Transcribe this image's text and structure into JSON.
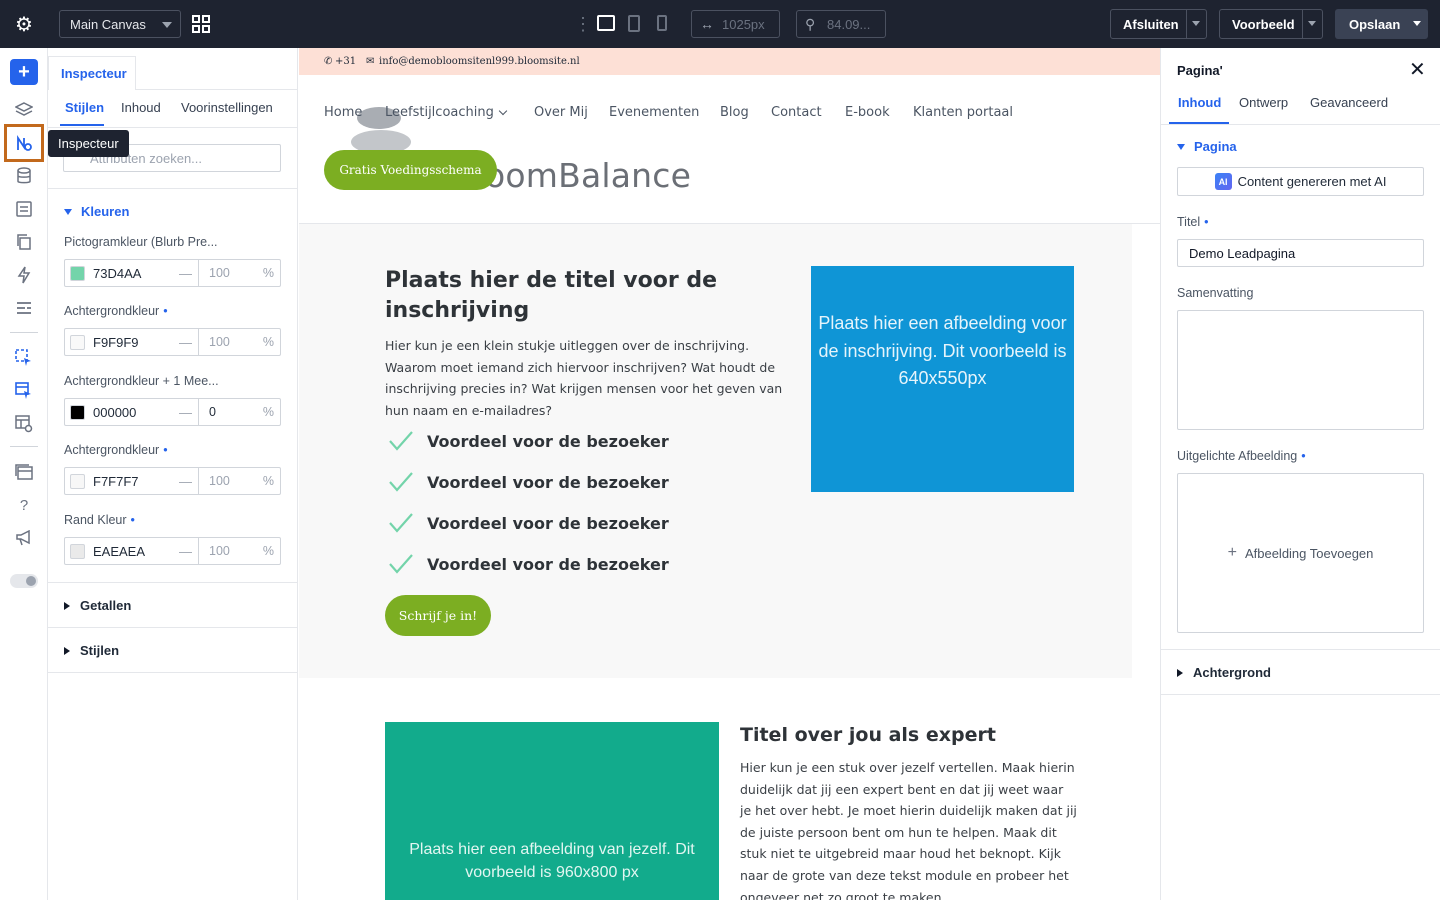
{
  "topbar": {
    "canvas_select": "Main Canvas",
    "width_value": "1025px",
    "zoom_value": "84.09...",
    "close_label": "Afsluiten",
    "preview_label": "Voorbeeld",
    "save_label": "Opslaan"
  },
  "rail": {
    "tooltip": "Inspecteur",
    "help_glyph": "?"
  },
  "inspector": {
    "tab_label": "Inspecteur",
    "subtabs": [
      "Stijlen",
      "Inhoud",
      "Voorinstellingen"
    ],
    "search_placeholder": "Attributen zoeken...",
    "colors_section": "Kleuren",
    "colors": [
      {
        "label": "Pictogramkleur (Blurb Pre...",
        "hex": "73D4AA",
        "opacity": "100",
        "swatch": "#73D4AA",
        "modified": false
      },
      {
        "label": "Achtergrondkleur",
        "hex": "F9F9F9",
        "opacity": "100",
        "swatch": "#F9F9F9",
        "modified": true
      },
      {
        "label": "Achtergrondkleur + 1 Mee...",
        "hex": "000000",
        "opacity": "0",
        "swatch": "#000000",
        "modified": false
      },
      {
        "label": "Achtergrondkleur",
        "hex": "F7F7F7",
        "opacity": "100",
        "swatch": "#F7F7F7",
        "modified": true
      },
      {
        "label": "Rand Kleur",
        "hex": "EAEAEA",
        "opacity": "100",
        "swatch": "#EAEAEA",
        "modified": true
      }
    ],
    "percent": "%",
    "numbers_section": "Getallen",
    "styles_section": "Stijlen"
  },
  "canvas": {
    "phone": "+31",
    "email": "info@demobloomsitenl999.bloomsite.nl",
    "logo_text": "oomBalance",
    "nav": [
      "Home",
      "Leefstijlcoaching",
      "Over Mij",
      "Evenementen",
      "Blog",
      "Contact",
      "E-book",
      "Klanten portaal"
    ],
    "cta_header": "Gratis Voedingsschema",
    "hero_title": "Plaats hier de titel voor de inschrijving",
    "hero_text": "Hier kun je een klein stukje uitleggen over de inschrijving. Waarom moet iemand zich hiervoor inschrijven? Wat houdt de inschrijving precies in? Wat krijgen mensen voor het geven van hun naam en e-mailadres?",
    "benefits": [
      "Voordeel voor de bezoeker",
      "Voordeel voor de bezoeker",
      "Voordeel voor de bezoeker",
      "Voordeel voor de bezoeker"
    ],
    "cta_signup": "Schrijf je in!",
    "image_placeholder_1": "Plaats hier een afbeelding voor de inschrijving. Dit voorbeeld is 640x550px",
    "image_placeholder_2": "Plaats hier een afbeelding van jezelf. Dit voorbeeld is 960x800 px",
    "expert_title": "Titel over jou als expert",
    "expert_text": "Hier kun je een stuk over jezelf vertellen. Maak hierin duidelijk dat jij een expert bent en dat jij weet waar je het over hebt. Je moet hierin duidelijk maken dat jij de juiste persoon bent om hun te helpen. Maak dit stuk niet te uitgebreid maar houd het beknopt. Kijk naar de grote van deze tekst module en probeer het ongeveer net zo groot te maken."
  },
  "rpanel": {
    "title": "Pagina'",
    "tabs": [
      "Inhoud",
      "Ontwerp",
      "Geavanceerd"
    ],
    "page_section": "Pagina",
    "ai_badge": "AI",
    "ai_button": "Content genereren met AI",
    "title_label": "Titel",
    "title_value": "Demo Leadpagina",
    "summary_label": "Samenvatting",
    "featured_label": "Uitgelichte Afbeelding",
    "add_image": "Afbeelding Toevoegen",
    "background_section": "Achtergrond"
  },
  "colors": {
    "accent": "#2563eb",
    "topbar": "#1e2330",
    "brand_green": "#7cae22",
    "placeholder_blue": "#0f95d6",
    "placeholder_teal": "#12ab8c",
    "check_color": "#73D4AA",
    "active_rail": "#c2691c"
  }
}
